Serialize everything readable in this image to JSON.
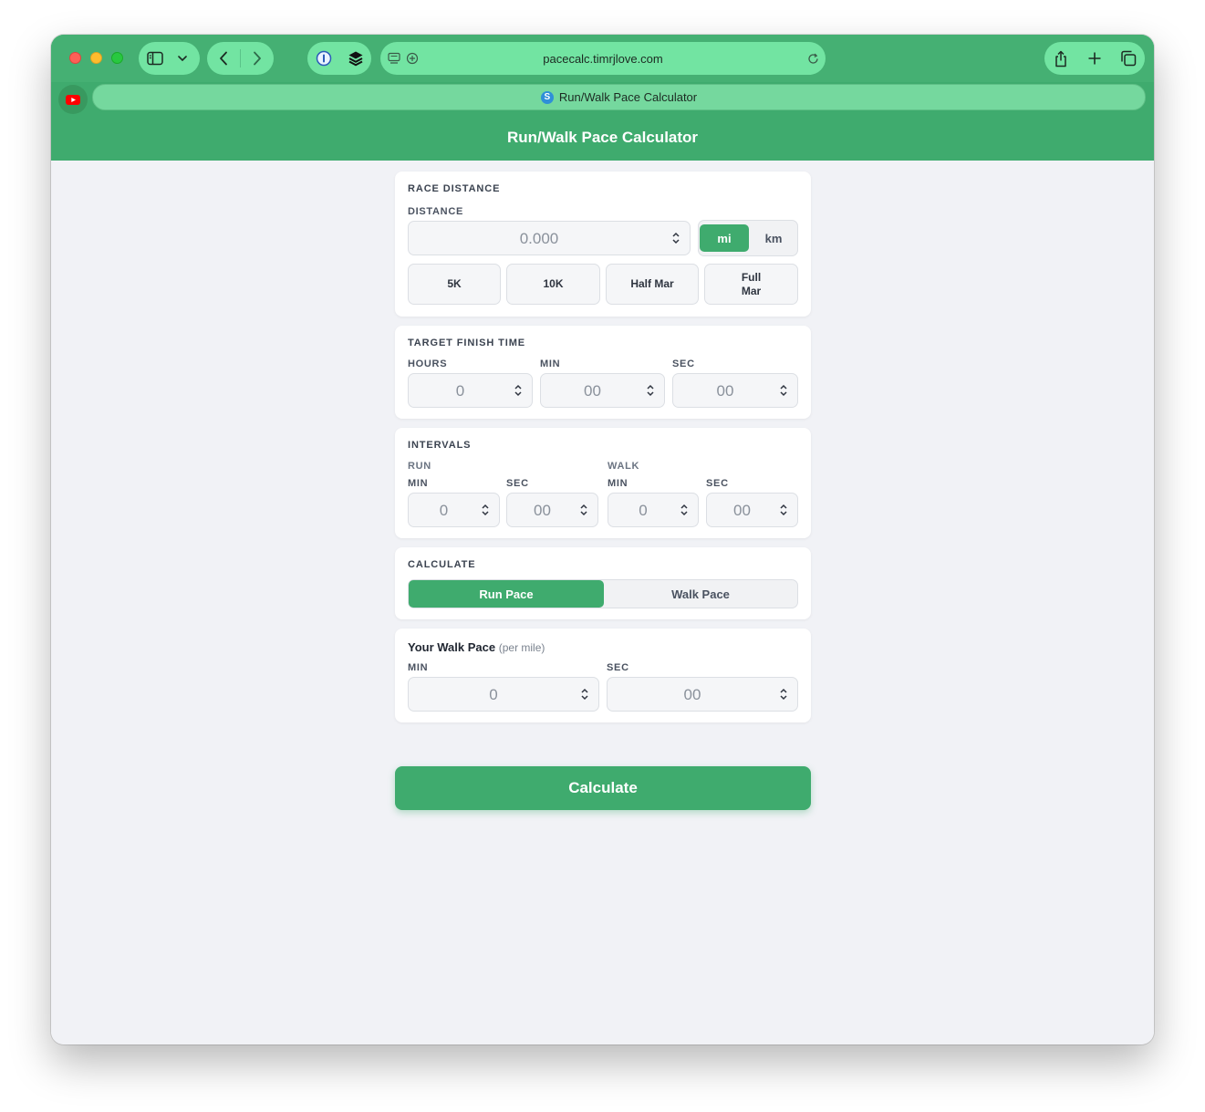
{
  "browser": {
    "url": "pacecalc.timrjlove.com",
    "tab_title": "Run/Walk Pace Calculator",
    "tab_favicon_letter": "S"
  },
  "app": {
    "title": "Run/Walk Pace Calculator"
  },
  "race_distance": {
    "section_title": "RACE DISTANCE",
    "distance_label": "DISTANCE",
    "distance_value": "0.000",
    "units": [
      "mi",
      "km"
    ],
    "selected_unit": "mi",
    "presets": [
      "5K",
      "10K",
      "Half Mar",
      "Full Mar"
    ]
  },
  "target_time": {
    "section_title": "TARGET FINISH TIME",
    "hours_label": "HOURS",
    "min_label": "MIN",
    "sec_label": "SEC",
    "hours_value": "0",
    "min_value": "00",
    "sec_value": "00"
  },
  "intervals": {
    "section_title": "INTERVALS",
    "run_label": "RUN",
    "walk_label": "WALK",
    "min_label": "MIN",
    "sec_label": "SEC",
    "run_min": "0",
    "run_sec": "00",
    "walk_min": "0",
    "walk_sec": "00"
  },
  "calculate_mode": {
    "section_title": "CALCULATE",
    "options": [
      "Run Pace",
      "Walk Pace"
    ],
    "selected": "Run Pace"
  },
  "walk_pace": {
    "title": "Your Walk Pace",
    "subtitle": "(per mile)",
    "min_label": "MIN",
    "sec_label": "SEC",
    "min_value": "0",
    "sec_value": "00"
  },
  "actions": {
    "calculate_label": "Calculate"
  },
  "colors": {
    "accent": "#3fab6e",
    "background": "#f1f2f6"
  }
}
